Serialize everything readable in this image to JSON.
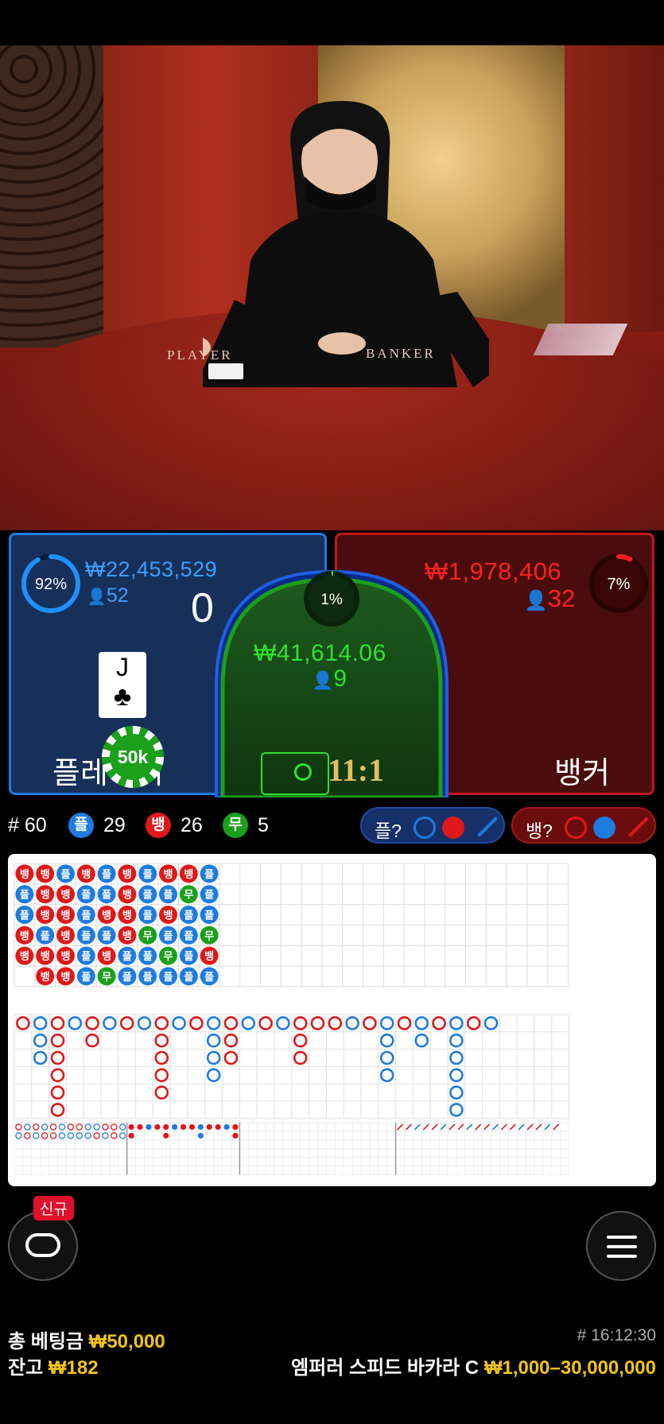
{
  "colors": {
    "player": "#1e7be0",
    "banker": "#e01818",
    "tie": "#1aa01a",
    "gold": "#f2c418"
  },
  "table": {
    "player_word": "PLAYER",
    "banker_word": "BANKER"
  },
  "player": {
    "percent": "92%",
    "amount": "₩22,453,529",
    "bettors": "52",
    "score": "0",
    "label": "플레이어",
    "card": {
      "rank": "J",
      "suit": "♣"
    },
    "chip": "50k",
    "percent_value": 92
  },
  "banker": {
    "percent": "7%",
    "amount": "₩1,978,406",
    "bettors": "32",
    "label": "뱅커",
    "percent_value": 7
  },
  "tie": {
    "percent": "1%",
    "amount": "₩41,614.06",
    "bettors": "9",
    "payout": "11:1",
    "percent_value": 1
  },
  "stats": {
    "round": "# 60",
    "player_badge": "플",
    "player_count": "29",
    "banker_badge": "뱅",
    "banker_count": "26",
    "tie_badge": "무",
    "tie_count": "5"
  },
  "predict": {
    "player_label": "플?",
    "banker_label": "뱅?"
  },
  "bead_road": [
    [
      "뱅",
      "플",
      "플",
      "뱅",
      "뱅"
    ],
    [
      "뱅",
      "뱅",
      "뱅",
      "플",
      "뱅",
      "뱅"
    ],
    [
      "플",
      "뱅",
      "뱅",
      "뱅",
      "뱅",
      "뱅"
    ],
    [
      "뱅",
      "플",
      "플",
      "플",
      "플",
      "플"
    ],
    [
      "플",
      "플",
      "뱅",
      "플",
      "뱅",
      "무"
    ],
    [
      "뱅",
      "뱅",
      "뱅",
      "뱅",
      "플",
      "플"
    ],
    [
      "플",
      "플",
      "플",
      "무",
      "플",
      "플"
    ],
    [
      "뱅",
      "플",
      "뱅",
      "플",
      "무",
      "플"
    ],
    [
      "뱅",
      "무",
      "플",
      "플",
      "플",
      "플"
    ],
    [
      "플",
      "플",
      "플",
      "무",
      "뱅",
      "플"
    ]
  ],
  "big_road_cols": [
    {
      "c": "r",
      "n": 1
    },
    {
      "c": "b",
      "n": 3
    },
    {
      "c": "r",
      "n": 6
    },
    {
      "c": "b",
      "n": 1
    },
    {
      "c": "r",
      "n": 2
    },
    {
      "c": "b",
      "n": 1
    },
    {
      "c": "r",
      "n": 1
    },
    {
      "c": "b",
      "n": 1
    },
    {
      "c": "r",
      "n": 5
    },
    {
      "c": "b",
      "n": 1
    },
    {
      "c": "r",
      "n": 1
    },
    {
      "c": "b",
      "n": 4
    },
    {
      "c": "r",
      "n": 3
    },
    {
      "c": "b",
      "n": 1
    },
    {
      "c": "r",
      "n": 1
    },
    {
      "c": "b",
      "n": 1
    },
    {
      "c": "r",
      "n": 3
    },
    {
      "c": "r",
      "n": 1
    },
    {
      "c": "r",
      "n": 1
    },
    {
      "c": "b",
      "n": 1
    },
    {
      "c": "r",
      "n": 1
    },
    {
      "c": "b",
      "n": 4
    },
    {
      "c": "r",
      "n": 1
    },
    {
      "c": "b",
      "n": 2
    },
    {
      "c": "r",
      "n": 1
    },
    {
      "c": "b",
      "n": 6
    },
    {
      "c": "r",
      "n": 1
    },
    {
      "c": "b",
      "n": 1
    }
  ],
  "footer": {
    "total_bet_label": "총 베팅금",
    "total_bet": "₩50,000",
    "balance_label": "잔고",
    "balance": "₩182",
    "round_id": "# 16:12:30",
    "table_name": "엠퍼러 스피드 바카라 C",
    "limits": "₩1,000–30,000,000",
    "new_badge": "신규"
  }
}
